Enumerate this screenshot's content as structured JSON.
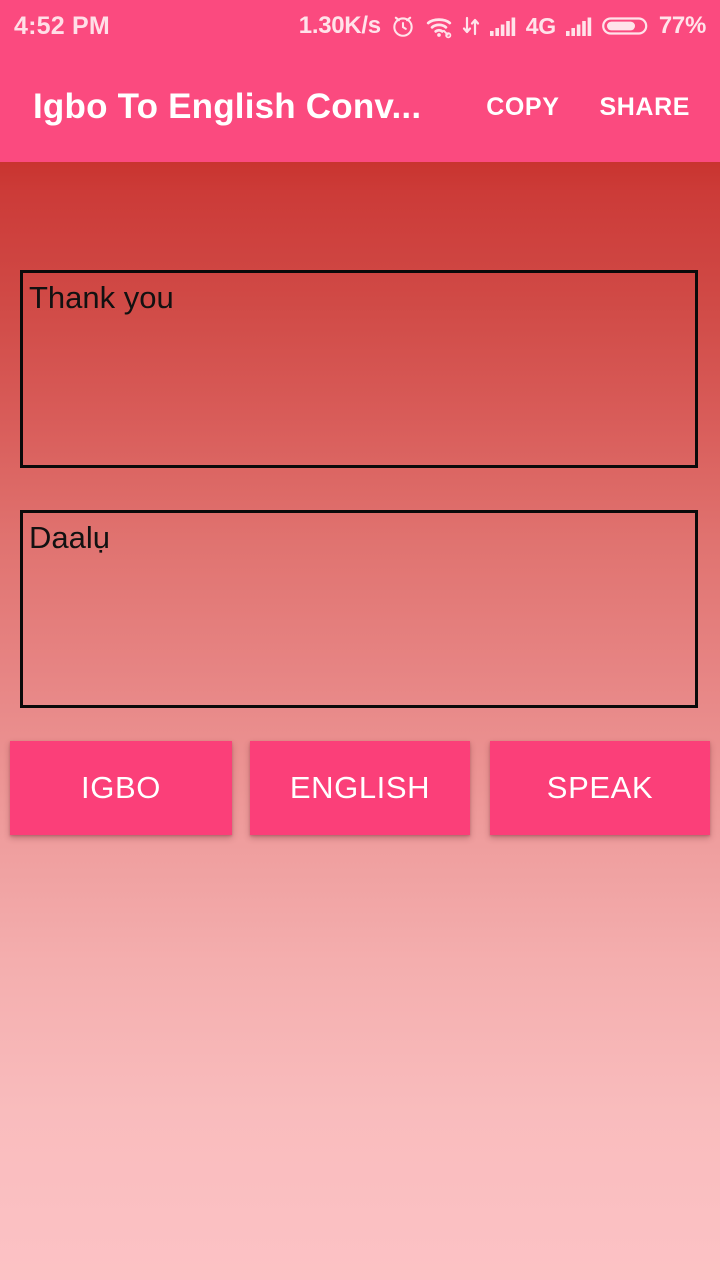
{
  "status_bar": {
    "clock": "4:52 PM",
    "network_speed": "1.30K/s",
    "alarm_icon": "alarm-clock-icon",
    "wifi_icon": "wifi-icon",
    "data_transfer_icon": "data-transfer-arrows-icon",
    "signal1_icon": "signal-bars-icon",
    "network_type": "4G",
    "signal2_icon": "signal-bars-icon",
    "battery_icon": "battery-icon",
    "battery_percent": "77%",
    "background_color": "#fb4a7f",
    "text_color": "#ffe3ea"
  },
  "app_bar": {
    "title": "Igbo To English Conv...",
    "copy_label": "COPY",
    "share_label": "SHARE",
    "background_color": "#fb4a7f",
    "text_color": "#ffffff"
  },
  "translator": {
    "english_box": {
      "value": "Thank you",
      "placeholder": ""
    },
    "igbo_box": {
      "value": "Daalụ",
      "placeholder": ""
    }
  },
  "buttons": {
    "igbo_label": "IGBO",
    "english_label": "ENGLISH",
    "speak_label": "SPEAK",
    "color": "#fb3f79",
    "text_color": "#ffffff"
  },
  "background": {
    "gradient_top_color": "#c9342f",
    "gradient_bottom_color": "#fcc2c5"
  }
}
